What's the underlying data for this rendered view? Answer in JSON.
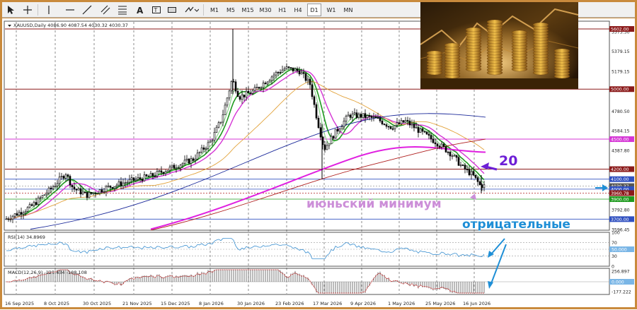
{
  "toolbar": {
    "timeframes": [
      "M1",
      "M5",
      "M15",
      "M30",
      "H1",
      "H4",
      "D1",
      "W1",
      "MN"
    ],
    "selected_timeframe": "D1"
  },
  "chart_info": {
    "symbol_line": "XAUUSD,Daily  4086.90 4087.54 4030.32 4030.37"
  },
  "price_scale": {
    "labels": [
      "5575.50",
      "5379.15",
      "5179.15",
      "4780.50",
      "4584.15",
      "4387.80",
      "3792.80",
      "3596.45"
    ],
    "line_labels": [
      {
        "text": "5602.00",
        "kind": "red"
      },
      {
        "text": "5000.00",
        "kind": "red"
      },
      {
        "text": "4500.00",
        "kind": "magenta"
      },
      {
        "text": "4200.00",
        "kind": "red"
      },
      {
        "text": "4100.00",
        "kind": "blue"
      },
      {
        "text": "4030.37",
        "kind": "darkgray"
      },
      {
        "text": "4000.00",
        "kind": "blue"
      },
      {
        "text": "3960.78",
        "kind": "red"
      },
      {
        "text": "3900.00",
        "kind": "green"
      },
      {
        "text": "3700.00",
        "kind": "blue"
      }
    ]
  },
  "time_axis": [
    "16 Sep 2025",
    "8 Oct 2025",
    "30 Oct 2025",
    "21 Nov 2025",
    "15 Dec 2025",
    "8 Jan 2026",
    "30 Jan 2026",
    "23 Feb 2026",
    "17 Mar 2026",
    "9 Apr 2026",
    "1 May 2026",
    "25 May 2026",
    "16 Jun 2026"
  ],
  "annotations": {
    "ma_label": "20",
    "june_low": "июньский минимум",
    "negative": "отрицательные"
  },
  "rsi": {
    "label": "RSI(14) 34.8969",
    "levels": [
      "100",
      "70",
      "50.000",
      "30",
      "0"
    ]
  },
  "macd": {
    "label": "MACD(12,26,9) -121.434 -108.108",
    "levels": [
      "256.897",
      "0.000",
      "-177.222"
    ]
  },
  "colors": {
    "up": "#000000",
    "ma_green": "#1e9a1e",
    "ma_magenta": "#d535d5",
    "ma_orange": "#e2a23a",
    "ma_navy": "#1c2a9a",
    "ma_red": "#b02020",
    "annotation_purple": "#6d1fd6",
    "annotation_pink": "#c88bd5",
    "annotation_blue": "#1f8fd6"
  }
}
